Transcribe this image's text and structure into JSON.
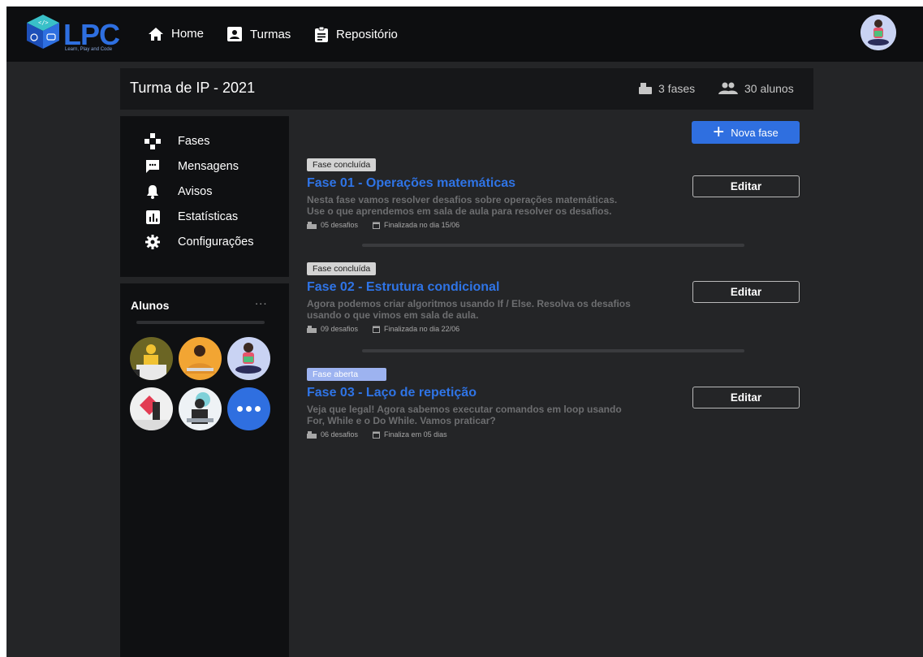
{
  "nav": {
    "logo_text": "LPC",
    "logo_tagline": "Learn, Play and Code",
    "links": [
      {
        "label": "Home",
        "icon": "home-icon"
      },
      {
        "label": "Turmas",
        "icon": "badge-icon"
      },
      {
        "label": "Repositório",
        "icon": "clipboard-icon"
      }
    ]
  },
  "header": {
    "title": "Turma de IP - 2021",
    "phases_count": "3 fases",
    "students_count": "30 alunos"
  },
  "menu": {
    "items": [
      {
        "label": "Fases",
        "icon": "gamepad-icon"
      },
      {
        "label": "Mensagens",
        "icon": "message-icon"
      },
      {
        "label": "Avisos",
        "icon": "bell-icon"
      },
      {
        "label": "Estatísticas",
        "icon": "chart-icon"
      },
      {
        "label": "Configurações",
        "icon": "gear-icon"
      }
    ]
  },
  "students": {
    "title": "Alunos",
    "more": "..."
  },
  "actions": {
    "new_phase": "Nova fase",
    "edit": "Editar"
  },
  "phases": [
    {
      "status": "Fase concluída",
      "title": "Fase 01 - Operações matemáticas",
      "desc": "Nesta fase vamos resolver desafios sobre operações matemáticas. Use o que aprendemos em sala de aula para resolver os desafios.",
      "challenges": "05 desafios",
      "date": "Finalizada no dia 15/06"
    },
    {
      "status": "Fase concluída",
      "title": "Fase 02 - Estrutura condicional",
      "desc": "Agora podemos criar algoritmos usando If / Else. Resolva os desafios usando o que vimos em sala de aula.",
      "challenges": "09 desafios",
      "date": "Finalizada no dia 22/06"
    },
    {
      "status": "Fase aberta",
      "title": "Fase 03 - Laço de repetição",
      "desc": "Veja que legal! Agora sabemos executar comandos em loop usando For, While e o Do While. Vamos praticar?",
      "challenges": "06 desafios",
      "date": "Finaliza em 05 dias"
    }
  ],
  "colors": {
    "accent": "#2f6fe0",
    "background": "#242527",
    "panel": "#0f1012",
    "phase_title": "#2f74e6"
  }
}
